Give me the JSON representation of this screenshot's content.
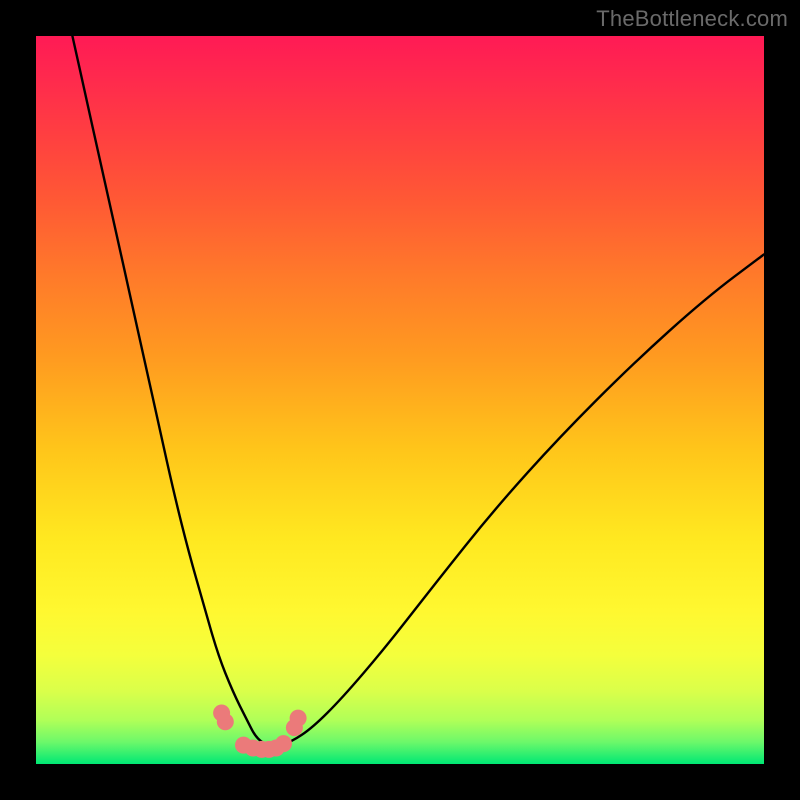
{
  "watermark": "TheBottleneck.com",
  "chart_data": {
    "type": "line",
    "title": "",
    "xlabel": "",
    "ylabel": "",
    "xlim": [
      0,
      100
    ],
    "ylim": [
      0,
      100
    ],
    "series": [
      {
        "name": "curve",
        "x": [
          5,
          7,
          9,
          11,
          13,
          15,
          17,
          19,
          21,
          23,
          25,
          27,
          29,
          30,
          31,
          32,
          33,
          35,
          38,
          42,
          48,
          55,
          63,
          72,
          82,
          92,
          100
        ],
        "values": [
          100,
          91,
          82,
          73,
          64,
          55,
          46,
          37,
          29,
          22,
          15,
          10,
          6,
          4,
          3,
          2.5,
          2.5,
          3,
          5,
          9,
          16,
          25,
          35,
          45,
          55,
          64,
          70
        ]
      },
      {
        "name": "dots",
        "x": [
          25.5,
          26.0,
          28.5,
          29.8,
          31.0,
          32.0,
          33.0,
          34.0,
          35.5,
          36.0
        ],
        "values": [
          7.0,
          5.8,
          2.6,
          2.2,
          2.0,
          2.0,
          2.2,
          2.8,
          5.0,
          6.3
        ]
      }
    ],
    "background_gradient": {
      "top": "#ff1a55",
      "mid": "#ffe820",
      "bottom": "#00e874"
    },
    "dot_color": "#eb7a7a",
    "curve_color": "#000000"
  }
}
